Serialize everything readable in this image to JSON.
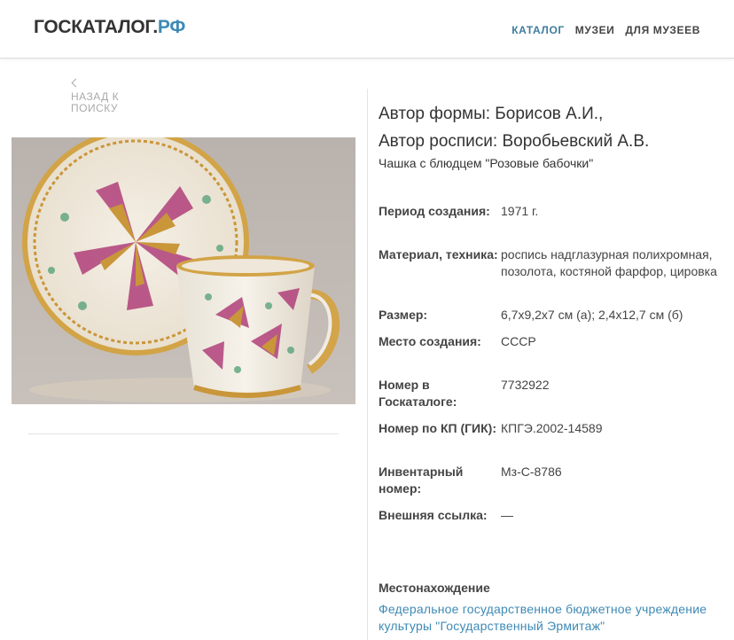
{
  "header": {
    "logo_main": "ГОСКАТАЛОГ.",
    "logo_rf": "РФ",
    "nav": [
      "КАТАЛОГ",
      "МУЗЕИ",
      "ДЛЯ МУЗЕЕВ"
    ]
  },
  "back_link": "НАЗАД К ПОИСКУ",
  "item": {
    "title_line1": "Автор формы: Борисов А.И.,",
    "title_line2": "Автор росписи: Воробьевский А.В.",
    "name": "Чашка с блюдцем \"Розовые бабочки\"",
    "properties": [
      {
        "label": "Период создания:",
        "value": "1971 г."
      },
      {
        "label": "Материал, техника:",
        "value": "роспись надглазурная полихромная, позолота, костяной фарфор, цировка"
      },
      {
        "label": "Размер:",
        "value": "6,7x9,2x7 см (а); 2,4x12,7 см (б)"
      },
      {
        "label": "Место создания:",
        "value": "СССР"
      },
      {
        "label": "Номер в Госкаталоге:",
        "value": "7732922"
      },
      {
        "label": "Номер по КП (ГИК):",
        "value": "КПГЭ.2002-14589"
      },
      {
        "label": "Инвентарный номер:",
        "value": "Мз-С-8786"
      },
      {
        "label": "Внешняя ссылка:",
        "value": "—"
      }
    ],
    "location_label": "Местонахождение",
    "location_value": "Федеральное государственное бюджетное учреждение культуры \"Государственный Эрмитаж\""
  },
  "colors": {
    "accent": "#3e8ab5",
    "nav_active": "#3e7c9e",
    "text": "#333333"
  }
}
